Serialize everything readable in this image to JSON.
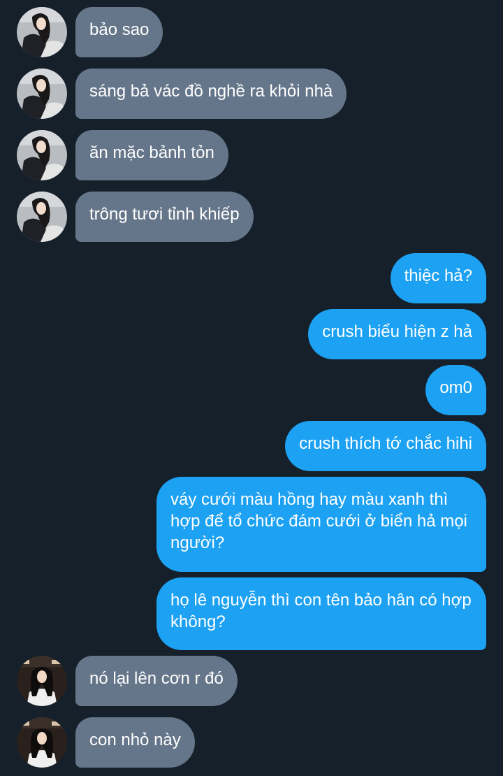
{
  "colors": {
    "background": "#15202b",
    "incoming_bubble": "#66768a",
    "outgoing_bubble": "#1da1f2",
    "text": "#ffffff"
  },
  "messages": [
    {
      "direction": "incoming",
      "avatar": "avatar-icon",
      "text": "bảo sao"
    },
    {
      "direction": "incoming",
      "avatar": "avatar-icon",
      "text": "sáng bả vác đồ nghề ra khỏi nhà"
    },
    {
      "direction": "incoming",
      "avatar": "avatar-icon",
      "text": "ăn mặc bảnh tỏn"
    },
    {
      "direction": "incoming",
      "avatar": "avatar-icon",
      "text": "trông tươi tỉnh khiếp"
    },
    {
      "direction": "outgoing",
      "text": "thiệc hả?"
    },
    {
      "direction": "outgoing",
      "text": "crush biểu hiện z hả"
    },
    {
      "direction": "outgoing",
      "text": "om0"
    },
    {
      "direction": "outgoing",
      "text": "crush thích tớ chắc hihi"
    },
    {
      "direction": "outgoing",
      "text": "váy cưới màu hồng hay màu xanh thì hợp để tổ chức đám cưới ở biển hả mọi người?"
    },
    {
      "direction": "outgoing",
      "text": "họ lê nguyễn thì con tên bảo hân có hợp không?"
    },
    {
      "direction": "incoming",
      "avatar": "avatar-icon",
      "text": "nó lại lên cơn r đó"
    },
    {
      "direction": "incoming",
      "avatar": "avatar-icon",
      "text": "con nhỏ này"
    }
  ]
}
